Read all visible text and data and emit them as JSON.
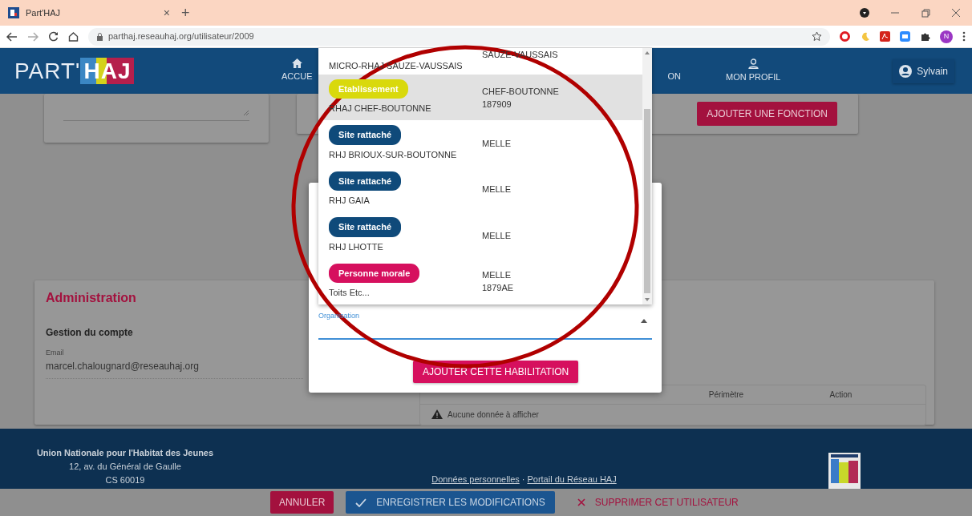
{
  "browser": {
    "tab_title": "Part'HAJ",
    "tab_close": "×",
    "new_tab": "+",
    "url": "parthaj.reseauhaj.org/utilisateur/2009",
    "profile_initial": "N"
  },
  "header": {
    "logo_light": "PART'",
    "logo_bold": "HAJ",
    "nav": [
      {
        "label": "ACCUE"
      },
      {
        "label": "ON"
      },
      {
        "label": "MON PROFIL"
      }
    ],
    "user": "Sylvain"
  },
  "function_card": {
    "button": "AJOUTER UNE FONCTION"
  },
  "administration": {
    "title": "Administration",
    "section": "Gestion du compte",
    "email_label": "Email",
    "email": "marcel.chalougnard@reseauhaj.org",
    "table": {
      "columns": [
        "Périmètre",
        "Action"
      ],
      "empty": "Aucune donnée à afficher"
    }
  },
  "footer": {
    "org": "Union Nationale pour l'Habitat des Jeunes",
    "address": [
      "12, av. du Général de Gaulle",
      "CS 60019"
    ],
    "links": [
      "Données personnelles",
      "Portail du Réseau HAJ"
    ],
    "separator": "·"
  },
  "action_bar": [
    {
      "label": "ANNULER",
      "kind": "cancel"
    },
    {
      "label": "ENREGISTRER LES MODIFICATIONS",
      "kind": "save"
    },
    {
      "label": "SUPPRIMER CET UTILISATEUR",
      "kind": "delete"
    }
  ],
  "modal": {
    "field": {
      "label": "Organisation",
      "expanded": true
    },
    "button": "AJOUTER CETTE HABILITATION"
  },
  "dropdown": {
    "items": [
      {
        "name": "MICRO-RHAJ SAUZE-VAUSSAIS",
        "city": "SAUZE-VAUSSAIS",
        "selected": false
      },
      {
        "badge": "Etablissement",
        "color": "#d9d90c",
        "name": "RHAJ CHEF-BOUTONNE",
        "city": "CHEF-BOUTONNE",
        "code": "187909",
        "selected": true
      },
      {
        "badge": "Site rattaché",
        "color": "#0f4a7a",
        "name": "RHJ BRIOUX-SUR-BOUTONNE",
        "city": "MELLE",
        "selected": false
      },
      {
        "badge": "Site rattaché",
        "color": "#0f4a7a",
        "name": "RHJ GAIA",
        "city": "MELLE",
        "selected": false
      },
      {
        "badge": "Site rattaché",
        "color": "#0f4a7a",
        "name": "RHJ LHOTTE",
        "city": "MELLE",
        "selected": false
      },
      {
        "badge": "Personne morale",
        "color": "#d6105e",
        "name": "Toits Etc...",
        "city": "MELLE",
        "code": "1879AE",
        "selected": false
      }
    ]
  }
}
